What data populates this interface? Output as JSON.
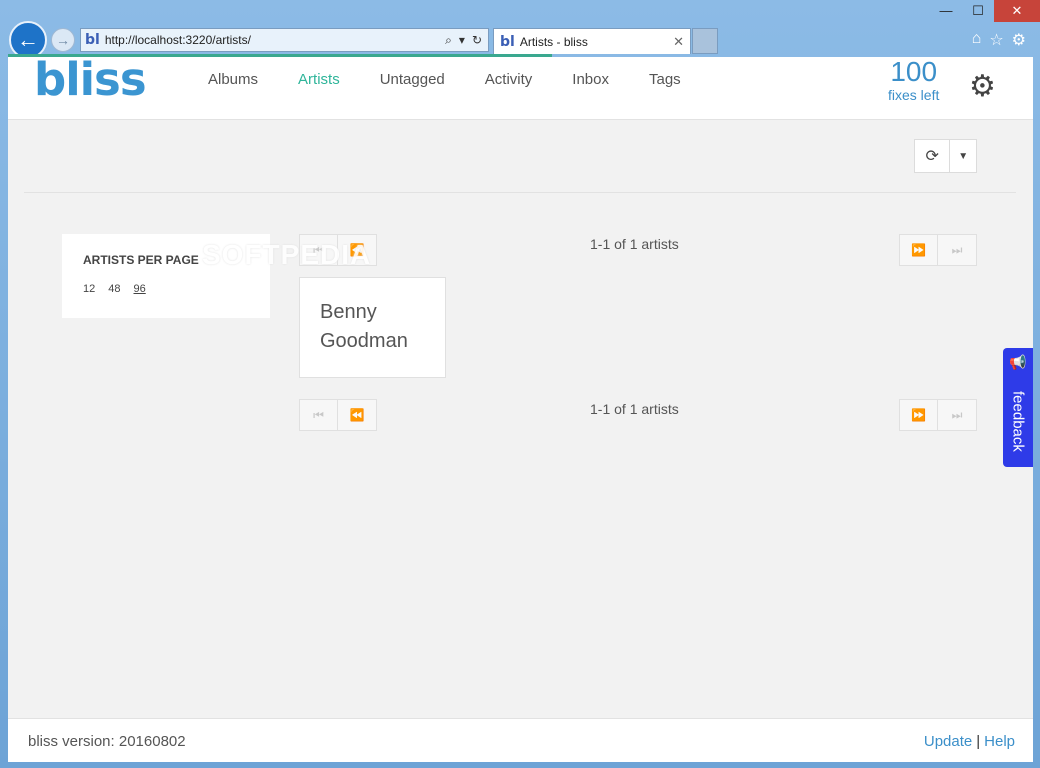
{
  "browser": {
    "url": "http://localhost:3220/artists/",
    "favicon_text": "bl",
    "tab_title": "Artists - bliss",
    "tab_close": "✕",
    "window_controls": [
      "—",
      "☐",
      "✕"
    ],
    "toolbar_icons": [
      "home-icon",
      "star-icon",
      "gear-icon"
    ]
  },
  "app": {
    "logo": "bliss",
    "nav": [
      "Albums",
      "Artists",
      "Untagged",
      "Activity",
      "Inbox",
      "Tags"
    ],
    "active_nav": "Artists",
    "fixes_count": "100",
    "fixes_label": "fixes left"
  },
  "per_page": {
    "title": "ARTISTS PER PAGE",
    "options": [
      "12",
      "48",
      "96"
    ],
    "selected": "96"
  },
  "pagination": {
    "top_count": "1-1 of 1 artists",
    "bottom_count": "1-1 of 1 artists"
  },
  "artists": [
    {
      "name_line1": "Benny",
      "name_line2": "Goodman"
    }
  ],
  "watermark": "SOFTPEDIA",
  "feedback": {
    "label": "feedback"
  },
  "footer": {
    "version": "bliss version: 20160802",
    "update": "Update",
    "separator": "|",
    "help": "Help"
  },
  "colors": {
    "brand": "#3b95d1",
    "active_nav": "#2fb59a",
    "feedback": "#2e3be8"
  }
}
